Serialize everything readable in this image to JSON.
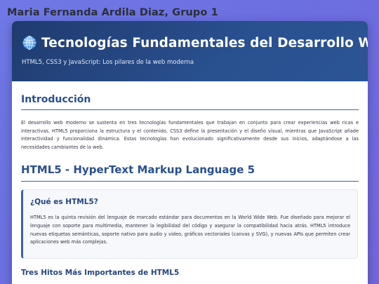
{
  "author": "Maria Fernanda Ardila Diaz, Grupo 1",
  "header": {
    "title": "Tecnologías Fundamentales del Desarrollo Web",
    "subtitle": "HTML5, CSS3 y JavaScript: Los pilares de la web moderna",
    "icon": "globe-icon"
  },
  "intro": {
    "heading": "Introducción",
    "text": "El desarrollo web moderno se sustenta en tres tecnologías fundamentales que trabajan en conjunto para crear experiencias web ricas e interactivas. HTML5 proporciona la estructura y el contenido, CSS3 define la presentación y el diseño visual, mientras que JavaScript añade interactividad y funcionalidad dinámica. Estas tecnologías han evolucionado significativamente desde sus inicios, adaptándose a las necesidades cambiantes de la web."
  },
  "html5": {
    "heading": "HTML5 - HyperText Markup Language 5",
    "box_heading": "¿Qué es HTML5?",
    "box_text": "HTML5 es la quinta revisión del lenguaje de marcado estándar para documentos en la World Wide Web. Fue diseñado para mejorar el lenguaje con soporte para multimedia, mantener la legibilidad del código y asegurar la compatibilidad hacia atrás. HTML5 introduce nuevas etiquetas semánticas, soporte nativo para audio y video, gráficos vectoriales (canvas y SVG), y nuevas APIs que permiten crear aplicaciones web más complejas.",
    "milestones_heading": "Tres Hitos Más Importantes de HTML5"
  },
  "colors": {
    "accent": "#29508f",
    "header_bg": "#1f3b6e",
    "page_bg": "#6f79e6"
  }
}
